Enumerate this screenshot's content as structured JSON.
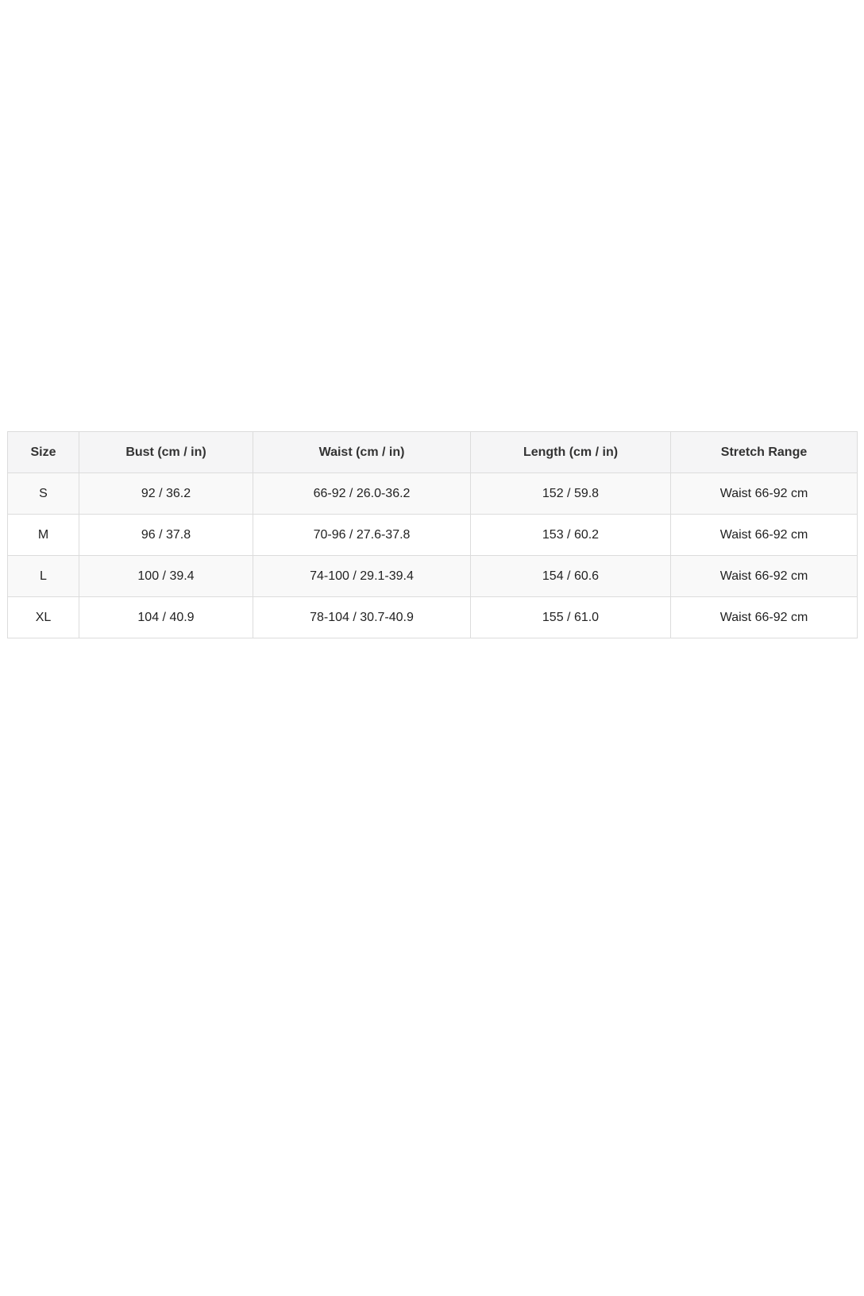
{
  "size_chart": {
    "headers": [
      "Size",
      "Bust (cm / in)",
      "Waist (cm / in)",
      "Length (cm / in)",
      "Stretch Range"
    ],
    "rows": [
      [
        "S",
        "92 / 36.2",
        "66-92 / 26.0-36.2",
        "152 / 59.8",
        "Waist 66-92 cm"
      ],
      [
        "M",
        "96 / 37.8",
        "70-96 / 27.6-37.8",
        "153 / 60.2",
        "Waist 66-92 cm"
      ],
      [
        "L",
        "100 / 39.4",
        "74-100 / 29.1-39.4",
        "154 / 60.6",
        "Waist 66-92 cm"
      ],
      [
        "XL",
        "104 / 40.9",
        "78-104 / 30.7-40.9",
        "155 / 61.0",
        "Waist 66-92 cm"
      ]
    ]
  }
}
